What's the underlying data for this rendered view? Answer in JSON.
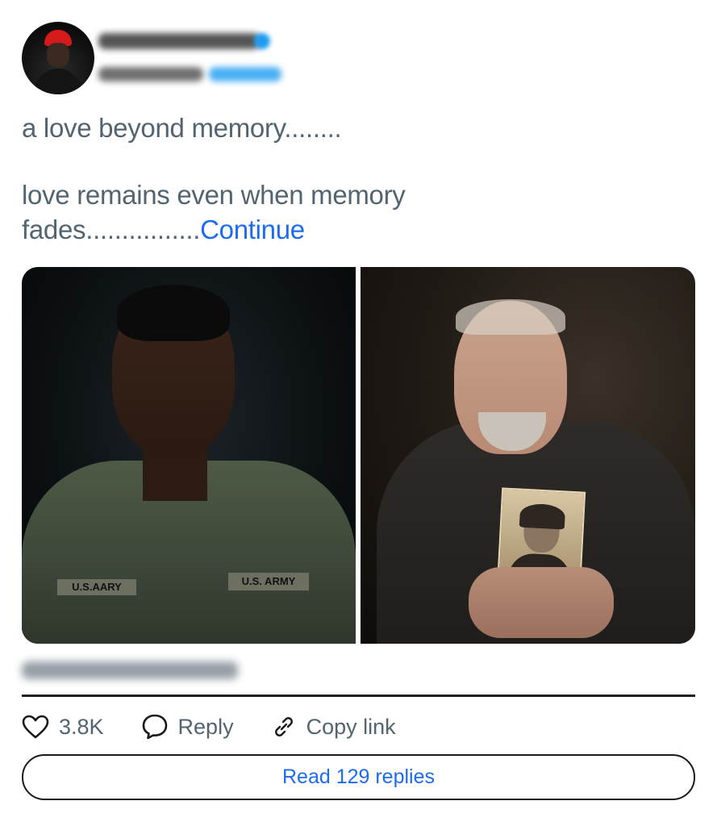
{
  "post": {
    "line1": "a love beyond memory........",
    "line2_main": "love remains even when memory fades................",
    "continue_label": "Continue"
  },
  "media": {
    "left_tag_1": "U.S.AARY",
    "left_tag_2": "U.S. ARMY"
  },
  "actions": {
    "likes": "3.8K",
    "reply_label": "Reply",
    "copy_link_label": "Copy link"
  },
  "replies_button": "Read 129 replies",
  "colors": {
    "link": "#1d6cf0",
    "muted_text": "#536471",
    "like_icon": "heart-outline-icon"
  }
}
